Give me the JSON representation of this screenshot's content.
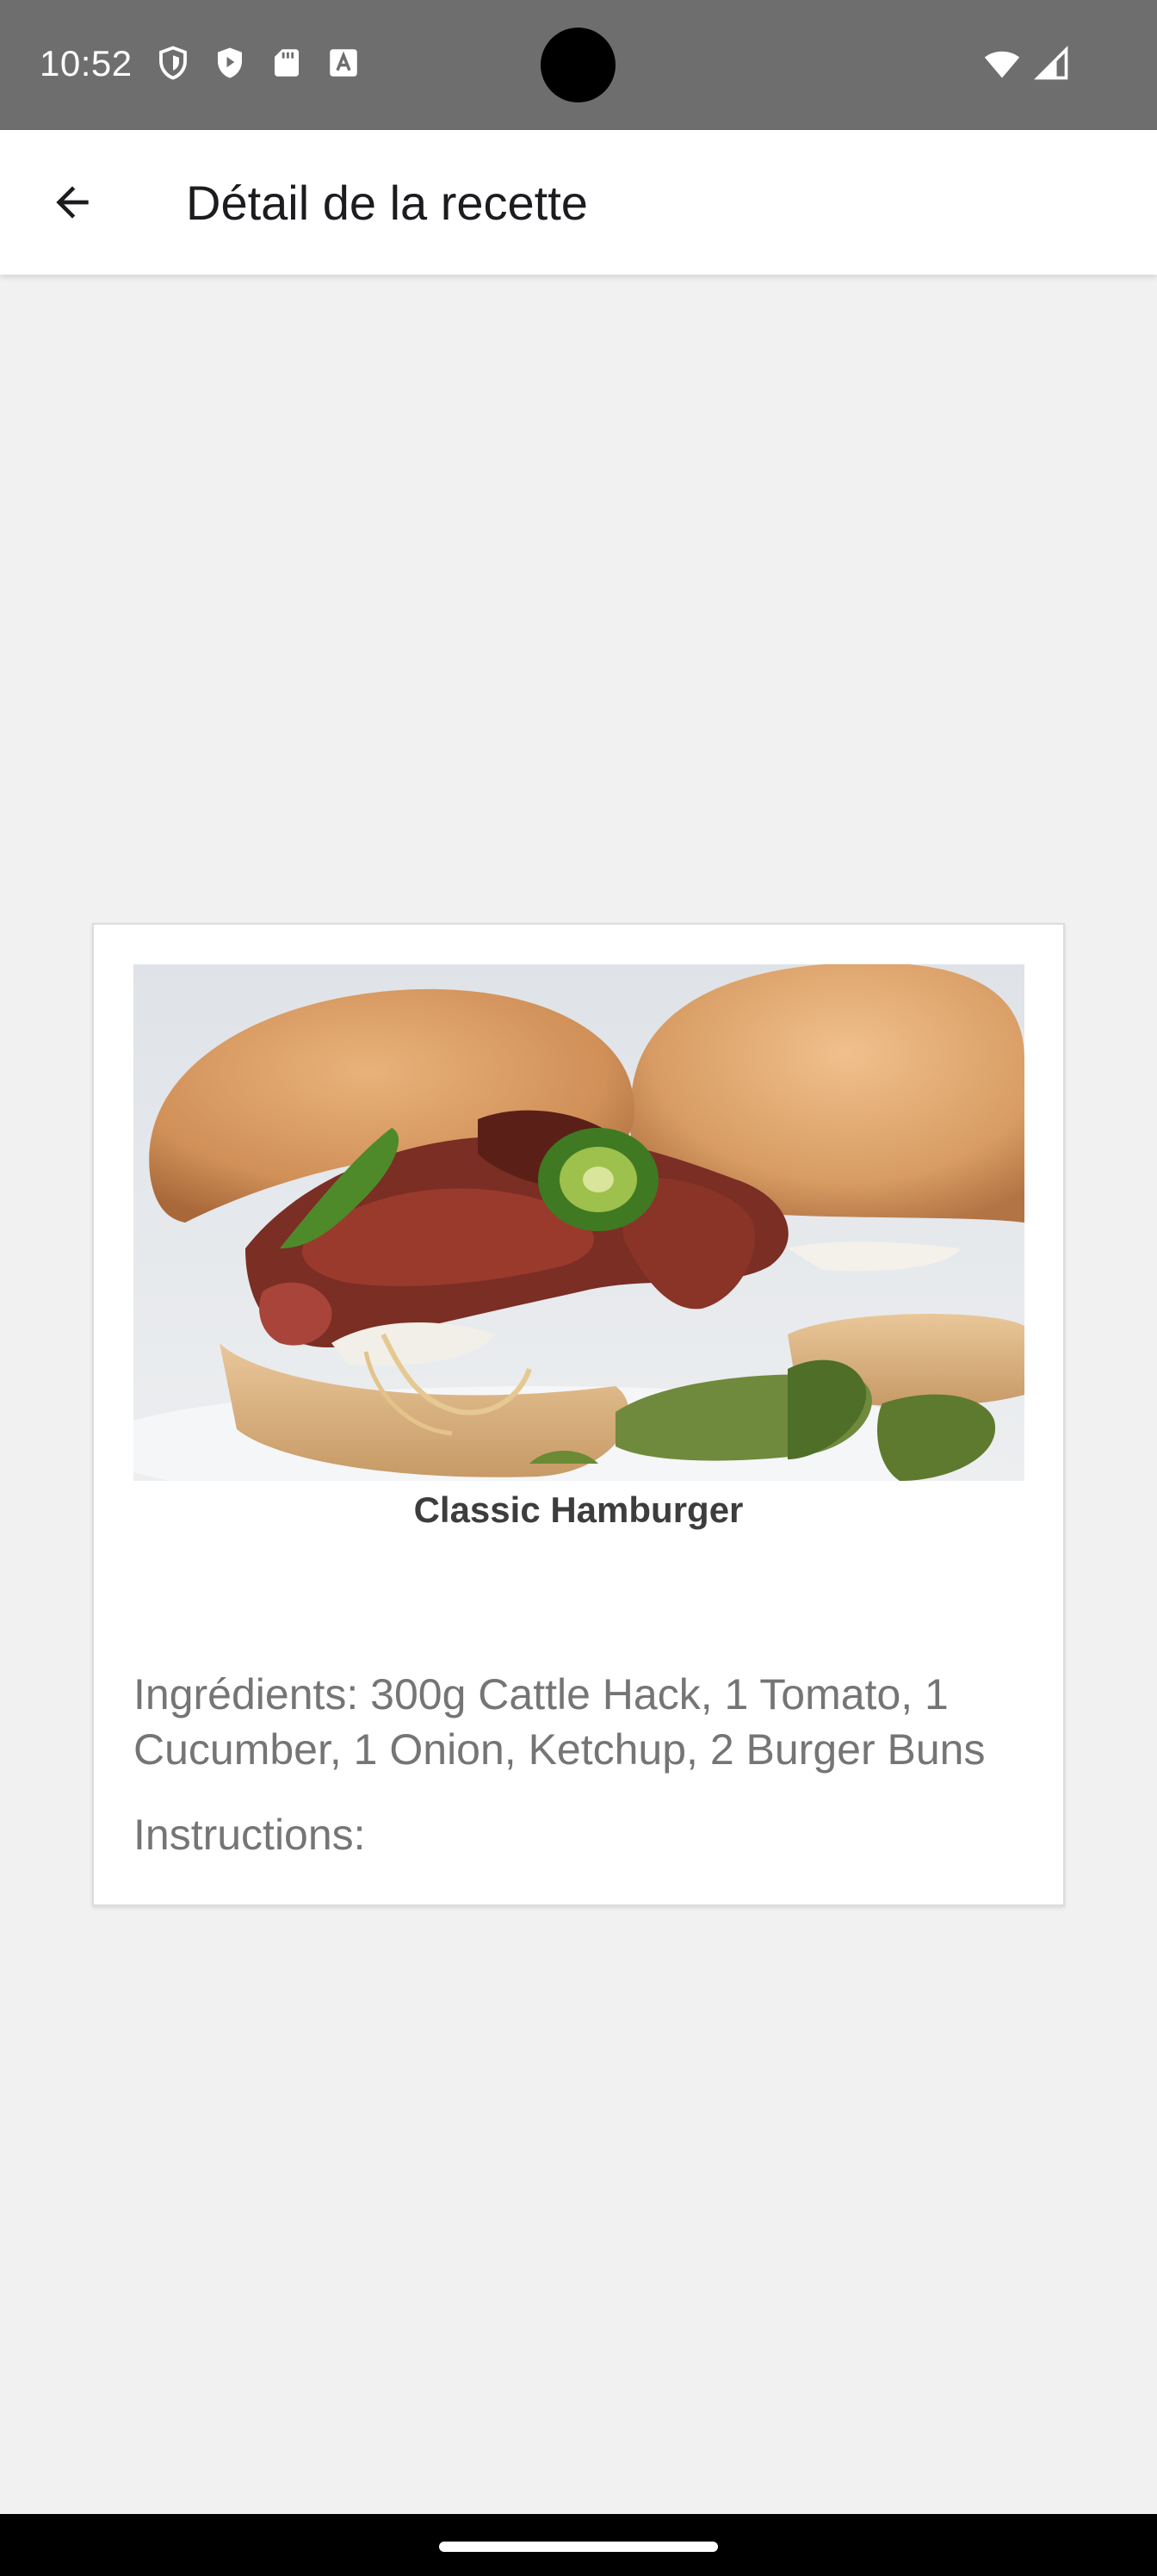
{
  "status_bar": {
    "time": "10:52",
    "left_icons": [
      "shield-icon",
      "play-protect-icon",
      "sd-card-icon",
      "font-icon"
    ],
    "right_icons": [
      "wifi-icon",
      "signal-icon"
    ]
  },
  "app_bar": {
    "title": "Détail de la recette",
    "back_icon": "arrow-back-icon"
  },
  "recipe": {
    "image_description_icon": "burger-photo",
    "title": "Classic Hamburger",
    "ingredients": "Ingrédients: 300g Cattle Hack, 1 Tomato, 1 Cucumber, 1 Onion, Ketchup, 2 Burger Buns",
    "instructions": "Instructions:"
  },
  "colors": {
    "status_bar": "#6e6e6e",
    "app_bar": "#ffffff",
    "background": "#f1f1f1",
    "card": "#ffffff",
    "secondary_text": "#757575"
  }
}
